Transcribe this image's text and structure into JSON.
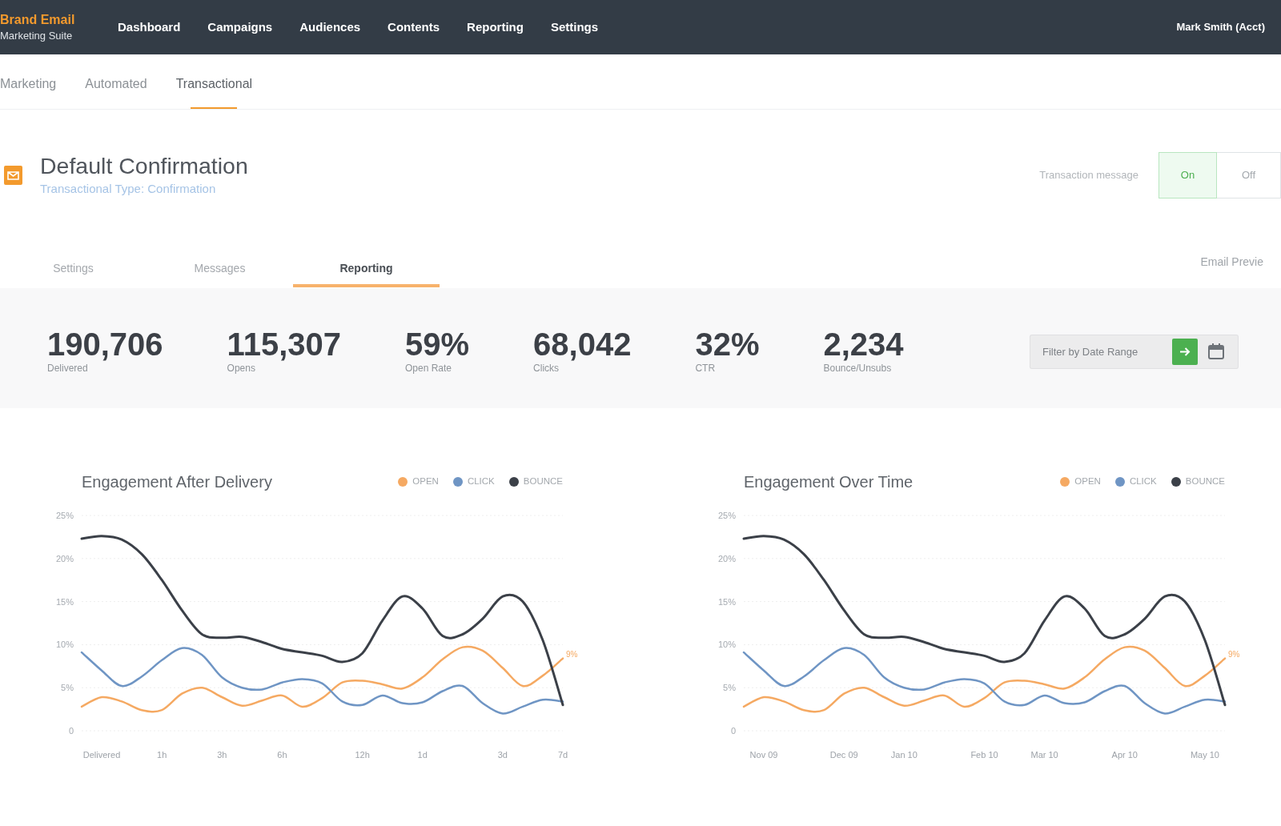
{
  "app": {
    "logo_title": "Brand Email",
    "logo_subtitle": "Marketing Suite"
  },
  "nav": {
    "items": [
      {
        "label": "Dashboard",
        "selected": false
      },
      {
        "label": "Campaigns",
        "selected": false
      },
      {
        "label": "Audiences",
        "selected": false
      },
      {
        "label": "Contents",
        "selected": false
      },
      {
        "label": "Reporting",
        "selected": false
      },
      {
        "label": "Settings",
        "selected": false
      }
    ],
    "user": "Mark Smith (Acct)"
  },
  "subnav": [
    {
      "label": "Marketing",
      "selected": false
    },
    {
      "label": "Automated",
      "selected": false
    },
    {
      "label": "Transactional",
      "selected": true
    }
  ],
  "header": {
    "title": "Default Confirmation",
    "subtitle": "Transactional Type: Confirmation",
    "toggle_label": "Transaction message",
    "toggle": [
      {
        "label": "On",
        "selected": true
      },
      {
        "label": "Off",
        "selected": false
      }
    ]
  },
  "tabs": [
    {
      "label": "Settings",
      "selected": false
    },
    {
      "label": "Messages",
      "selected": false
    },
    {
      "label": "Reporting",
      "selected": true
    }
  ],
  "preview_link": "Email Previe",
  "stats": [
    {
      "value": "190,706",
      "label": "Delivered"
    },
    {
      "value": "115,307",
      "label": "Opens"
    },
    {
      "value": "59%",
      "label": "Open Rate"
    },
    {
      "value": "68,042",
      "label": "Clicks"
    },
    {
      "value": "32%",
      "label": "CTR"
    },
    {
      "value": "2,234",
      "label": "Bounce/Unsubs"
    }
  ],
  "date_filter": {
    "placeholder": "Filter by Date Range"
  },
  "charts": [
    {
      "chart_data": {
        "type": "line",
        "title": "Engagement After Delivery",
        "categories": [
          null,
          "Delivered",
          null,
          null,
          "1h",
          null,
          null,
          "3h",
          null,
          null,
          "6h",
          null,
          null,
          null,
          "12h",
          null,
          null,
          "1d",
          null,
          null,
          null,
          "3d",
          null,
          null,
          "7d"
        ],
        "ylim": [
          0,
          25
        ],
        "yticks": [
          {
            "value": 0,
            "label": "0"
          },
          {
            "value": 5,
            "label": "5%"
          },
          {
            "value": 10,
            "label": "10%"
          },
          {
            "value": 15,
            "label": "15%"
          },
          {
            "value": 20,
            "label": "20%"
          },
          {
            "value": 25,
            "label": "25%"
          }
        ],
        "grid": true,
        "series": [
          {
            "name": "OPEN",
            "color": "#f5a962",
            "values": [
              2.8,
              3.9,
              3.4,
              2.4,
              2.4,
              4.3,
              5.0,
              3.9,
              2.9,
              3.5,
              4.1,
              2.8,
              3.8,
              5.6,
              5.8,
              5.4,
              4.9,
              6.2,
              8.3,
              9.7,
              9.3,
              7.3,
              5.2,
              6.4,
              8.4
            ]
          },
          {
            "name": "CLICK",
            "color": "#6f95c4",
            "values": [
              9.1,
              7.0,
              5.2,
              6.3,
              8.2,
              9.6,
              8.8,
              6.2,
              5.0,
              4.8,
              5.6,
              6.0,
              5.5,
              3.4,
              3.0,
              4.1,
              3.2,
              3.3,
              4.6,
              5.2,
              3.2,
              2.0,
              2.8,
              3.6,
              3.4
            ]
          },
          {
            "name": "BOUNCE",
            "color": "#3b4048",
            "values": [
              22.3,
              22.6,
              22.2,
              20.5,
              17.5,
              14.0,
              11.2,
              10.8,
              10.9,
              10.3,
              9.5,
              9.1,
              8.7,
              8.0,
              9.0,
              12.8,
              15.6,
              14.2,
              11.0,
              11.2,
              13.0,
              15.6,
              15.0,
              10.5,
              3.0
            ]
          }
        ],
        "annotations": [
          "9%"
        ]
      }
    },
    {
      "chart_data": {
        "type": "line",
        "title": "Engagement Over Time",
        "categories": [
          null,
          "Nov 09",
          null,
          null,
          null,
          "Dec 09",
          null,
          null,
          "Jan 10",
          null,
          null,
          null,
          "Feb 10",
          null,
          null,
          "Mar 10",
          null,
          null,
          null,
          "Apr 10",
          null,
          null,
          null,
          "May 10",
          null
        ],
        "ylim": [
          0,
          25
        ],
        "yticks": [
          {
            "value": 0,
            "label": "0"
          },
          {
            "value": 5,
            "label": "5%"
          },
          {
            "value": 10,
            "label": "10%"
          },
          {
            "value": 15,
            "label": "15%"
          },
          {
            "value": 20,
            "label": "20%"
          },
          {
            "value": 25,
            "label": "25%"
          }
        ],
        "grid": true,
        "series": [
          {
            "name": "OPEN",
            "color": "#f5a962",
            "values": [
              2.8,
              3.9,
              3.4,
              2.4,
              2.4,
              4.3,
              5.0,
              3.9,
              2.9,
              3.5,
              4.1,
              2.8,
              3.8,
              5.6,
              5.8,
              5.4,
              4.9,
              6.2,
              8.3,
              9.7,
              9.3,
              7.3,
              5.2,
              6.4,
              8.4
            ]
          },
          {
            "name": "CLICK",
            "color": "#6f95c4",
            "values": [
              9.1,
              7.0,
              5.2,
              6.3,
              8.2,
              9.6,
              8.8,
              6.2,
              5.0,
              4.8,
              5.6,
              6.0,
              5.5,
              3.4,
              3.0,
              4.1,
              3.2,
              3.3,
              4.6,
              5.2,
              3.2,
              2.0,
              2.8,
              3.6,
              3.4
            ]
          },
          {
            "name": "BOUNCE",
            "color": "#3b4048",
            "values": [
              22.3,
              22.6,
              22.2,
              20.5,
              17.5,
              14.0,
              11.2,
              10.8,
              10.9,
              10.3,
              9.5,
              9.1,
              8.7,
              8.0,
              9.0,
              12.8,
              15.6,
              14.2,
              11.0,
              11.2,
              13.0,
              15.6,
              15.0,
              10.5,
              3.0
            ]
          }
        ],
        "annotations": [
          "9%"
        ]
      }
    }
  ]
}
